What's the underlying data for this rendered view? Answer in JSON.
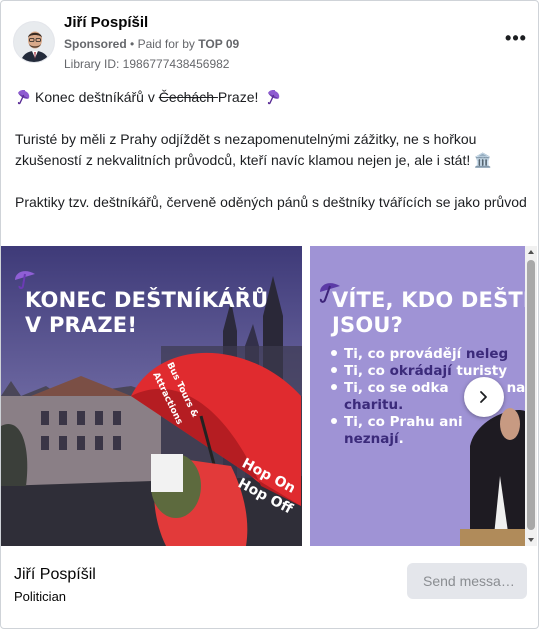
{
  "ad": {
    "author": "Jiří Pospíšil",
    "sponsored_label": "Sponsored",
    "separator": "•",
    "paid_for_by_label": "Paid for by",
    "paid_for_by_name": "TOP 09",
    "library_id": "Library ID: 1986777438456982",
    "more_label": "•••"
  },
  "body": {
    "line1_start": "Konec deštníkářů v ",
    "line1_strike": "Čechách ",
    "line1_end": "Praze!",
    "para2": "Turisté by měli z Prahy odjíždět s nezapomenutelnými zážitky, ne s hořkou zkušeností z nekvalitních průvodců, kteří navíc klamou nejen je, ale i stát! 🏛️",
    "para3": "Praktiky tzv. deštníkářů, červeně oděných pánů s deštníky tvářících se jako průvodci, zahrnují pouliční prodej prohlídkových jízd Prahou nic netušícím turistů…"
  },
  "slides": [
    {
      "headline_1": "KONEC DEŠTNÍKÁŘŮ",
      "headline_2": "V PRAZE!",
      "umbrella_text_1": "Bus Tours &",
      "umbrella_text_2": "Attractions",
      "umbrella_text_3": "Hop On",
      "umbrella_text_4": "Hop Off"
    },
    {
      "headline_1": "VÍTE, KDO DEŠTN",
      "headline_2": "JSOU?",
      "b1_a": "Ti, co provádějí ",
      "b1_b": "neleg",
      "b2_a": "Ti, co ",
      "b2_b": "okrádají",
      "b2_c": " turisty",
      "b3_a": "Ti, co se odka",
      "b3_b": "na",
      "b4": "charitu.",
      "b5": "Ti, co Prahu ani",
      "b6_a": "neznají",
      "b6_b": "."
    }
  ],
  "footer": {
    "name": "Jiří Pospíšil",
    "category": "Politician",
    "send_button": "Send messa…"
  },
  "colors": {
    "slide2_bg": "#9f93d5",
    "accent_purple": "#7b5cc7",
    "umbrella_red": "#e02b2f"
  }
}
